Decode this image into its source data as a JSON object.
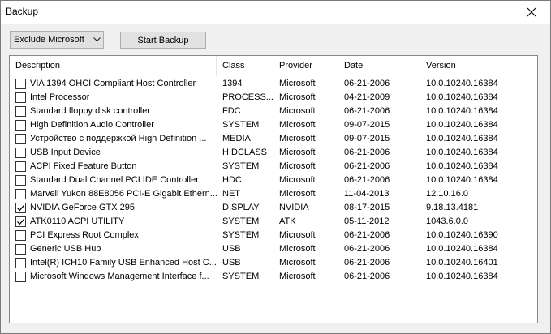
{
  "window": {
    "title": "Backup"
  },
  "toolbar": {
    "filter_value": "Exclude Microsoft",
    "start_label": "Start Backup"
  },
  "columns": [
    "Description",
    "Class",
    "Provider",
    "Date",
    "Version"
  ],
  "rows": [
    {
      "checked": false,
      "description": "VIA 1394 OHCI Compliant Host Controller",
      "class": "1394",
      "provider": "Microsoft",
      "date": "06-21-2006",
      "version": "10.0.10240.16384"
    },
    {
      "checked": false,
      "description": "Intel Processor",
      "class": "PROCESS...",
      "provider": "Microsoft",
      "date": "04-21-2009",
      "version": "10.0.10240.16384"
    },
    {
      "checked": false,
      "description": "Standard floppy disk controller",
      "class": "FDC",
      "provider": "Microsoft",
      "date": "06-21-2006",
      "version": "10.0.10240.16384"
    },
    {
      "checked": false,
      "description": "High Definition Audio Controller",
      "class": "SYSTEM",
      "provider": "Microsoft",
      "date": "09-07-2015",
      "version": "10.0.10240.16384"
    },
    {
      "checked": false,
      "description": "Устройство с поддержкой High Definition ...",
      "class": "MEDIA",
      "provider": "Microsoft",
      "date": "09-07-2015",
      "version": "10.0.10240.16384"
    },
    {
      "checked": false,
      "description": "USB Input Device",
      "class": "HIDCLASS",
      "provider": "Microsoft",
      "date": "06-21-2006",
      "version": "10.0.10240.16384"
    },
    {
      "checked": false,
      "description": "ACPI Fixed Feature Button",
      "class": "SYSTEM",
      "provider": "Microsoft",
      "date": "06-21-2006",
      "version": "10.0.10240.16384"
    },
    {
      "checked": false,
      "description": "Standard Dual Channel PCI IDE Controller",
      "class": "HDC",
      "provider": "Microsoft",
      "date": "06-21-2006",
      "version": "10.0.10240.16384"
    },
    {
      "checked": false,
      "description": "Marvell Yukon 88E8056 PCI-E Gigabit Ethern...",
      "class": "NET",
      "provider": "Microsoft",
      "date": "11-04-2013",
      "version": "12.10.16.0"
    },
    {
      "checked": true,
      "description": "NVIDIA GeForce GTX 295",
      "class": "DISPLAY",
      "provider": "NVIDIA",
      "date": "08-17-2015",
      "version": "9.18.13.4181"
    },
    {
      "checked": true,
      "description": "ATK0110 ACPI UTILITY",
      "class": "SYSTEM",
      "provider": "ATK",
      "date": "05-11-2012",
      "version": "1043.6.0.0"
    },
    {
      "checked": false,
      "description": "PCI Express Root Complex",
      "class": "SYSTEM",
      "provider": "Microsoft",
      "date": "06-21-2006",
      "version": "10.0.10240.16390"
    },
    {
      "checked": false,
      "description": "Generic USB Hub",
      "class": "USB",
      "provider": "Microsoft",
      "date": "06-21-2006",
      "version": "10.0.10240.16384"
    },
    {
      "checked": false,
      "description": "Intel(R) ICH10 Family USB Enhanced Host C...",
      "class": "USB",
      "provider": "Microsoft",
      "date": "06-21-2006",
      "version": "10.0.10240.16401"
    },
    {
      "checked": false,
      "description": "Microsoft Windows Management Interface f...",
      "class": "SYSTEM",
      "provider": "Microsoft",
      "date": "06-21-2006",
      "version": "10.0.10240.16384"
    }
  ]
}
